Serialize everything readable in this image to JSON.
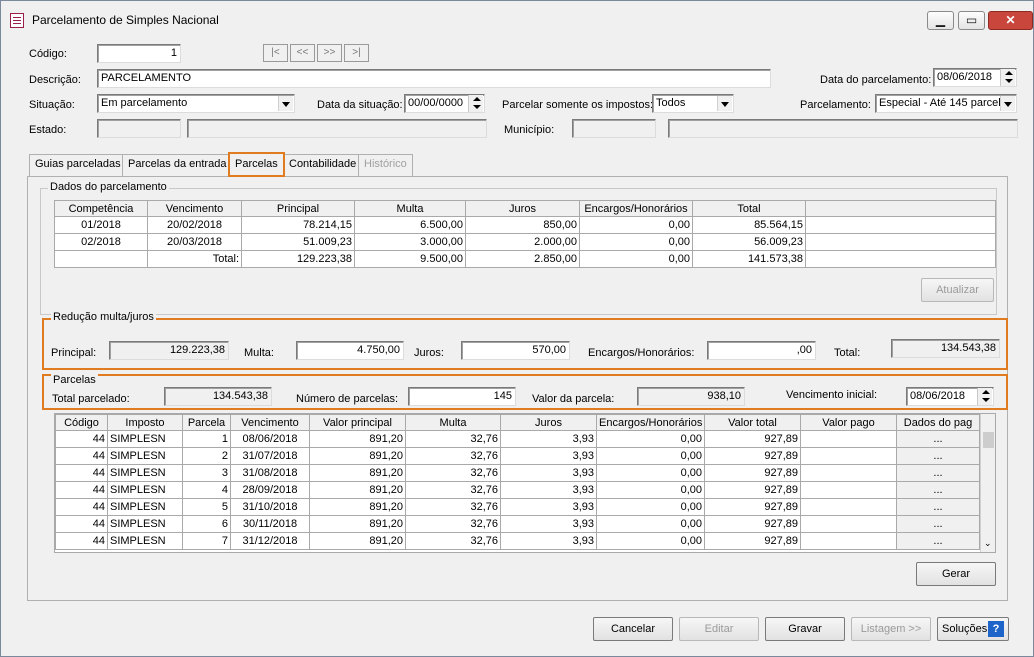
{
  "window": {
    "title": "Parcelamento de Simples Nacional",
    "min": "▁",
    "max": "▭",
    "close": "✕"
  },
  "form": {
    "codigo_label": "Código:",
    "codigo": "1",
    "nav": [
      "|<",
      "<<",
      ">>",
      ">|"
    ],
    "descricao_label": "Descrição:",
    "descricao": "PARCELAMENTO",
    "data_parcelamento_label": "Data do parcelamento:",
    "data_parcelamento": "08/06/2018",
    "situacao_label": "Situação:",
    "situacao": "Em parcelamento",
    "data_situacao_label": "Data da situação:",
    "data_situacao": "00/00/0000",
    "parcelar_label": "Parcelar somente os impostos:",
    "parcelar": "Todos",
    "parcelamento_label": "Parcelamento:",
    "parcelamento": "Especial - Até 145 parcel",
    "estado_label": "Estado:",
    "municipio_label": "Município:"
  },
  "tabs": [
    "Guias parceladas",
    "Parcelas da entrada",
    "Parcelas",
    "Contabilidade",
    "Histórico"
  ],
  "dados": {
    "title": "Dados do parcelamento",
    "headers": [
      "Competência",
      "Vencimento",
      "Principal",
      "Multa",
      "Juros",
      "Encargos/Honorários",
      "Total"
    ],
    "rows": [
      [
        "01/2018",
        "20/02/2018",
        "78.214,15",
        "6.500,00",
        "850,00",
        "0,00",
        "85.564,15"
      ],
      [
        "02/2018",
        "20/03/2018",
        "51.009,23",
        "3.000,00",
        "2.000,00",
        "0,00",
        "56.009,23"
      ]
    ],
    "total": [
      "",
      "Total:",
      "129.223,38",
      "9.500,00",
      "2.850,00",
      "0,00",
      "141.573,38"
    ],
    "atualizar": "Atualizar"
  },
  "reducao": {
    "title": "Redução multa/juros",
    "principal_label": "Principal:",
    "principal": "129.223,38",
    "multa_label": "Multa:",
    "multa": "4.750,00",
    "juros_label": "Juros:",
    "juros": "570,00",
    "encargos_label": "Encargos/Honorários:",
    "encargos": ",00",
    "total_label": "Total:",
    "total": "134.543,38"
  },
  "parcelas": {
    "title": "Parcelas",
    "total_label": "Total parcelado:",
    "total": "134.543,38",
    "numero_label": "Número de parcelas:",
    "numero": "145",
    "valor_label": "Valor da parcela:",
    "valor": "938,10",
    "venc_label": "Vencimento inicial:",
    "venc": "08/06/2018"
  },
  "grid": {
    "headers": [
      "Código",
      "Imposto",
      "Parcela",
      "Vencimento",
      "Valor principal",
      "Multa",
      "Juros",
      "Encargos/Honorários",
      "Valor total",
      "Valor pago",
      "Dados do pag"
    ],
    "rows": [
      [
        "44",
        "SIMPLESN",
        "1",
        "08/06/2018",
        "891,20",
        "32,76",
        "3,93",
        "0,00",
        "927,89",
        "",
        "..."
      ],
      [
        "44",
        "SIMPLESN",
        "2",
        "31/07/2018",
        "891,20",
        "32,76",
        "3,93",
        "0,00",
        "927,89",
        "",
        "..."
      ],
      [
        "44",
        "SIMPLESN",
        "3",
        "31/08/2018",
        "891,20",
        "32,76",
        "3,93",
        "0,00",
        "927,89",
        "",
        "..."
      ],
      [
        "44",
        "SIMPLESN",
        "4",
        "28/09/2018",
        "891,20",
        "32,76",
        "3,93",
        "0,00",
        "927,89",
        "",
        "..."
      ],
      [
        "44",
        "SIMPLESN",
        "5",
        "31/10/2018",
        "891,20",
        "32,76",
        "3,93",
        "0,00",
        "927,89",
        "",
        "..."
      ],
      [
        "44",
        "SIMPLESN",
        "6",
        "30/11/2018",
        "891,20",
        "32,76",
        "3,93",
        "0,00",
        "927,89",
        "",
        "..."
      ],
      [
        "44",
        "SIMPLESN",
        "7",
        "31/12/2018",
        "891,20",
        "32,76",
        "3,93",
        "0,00",
        "927,89",
        "",
        "..."
      ]
    ],
    "gerar": "Gerar"
  },
  "buttons": {
    "cancelar": "Cancelar",
    "editar": "Editar",
    "gravar": "Gravar",
    "listagem": "Listagem >>",
    "solucoes": "Soluções",
    "help": "?"
  }
}
